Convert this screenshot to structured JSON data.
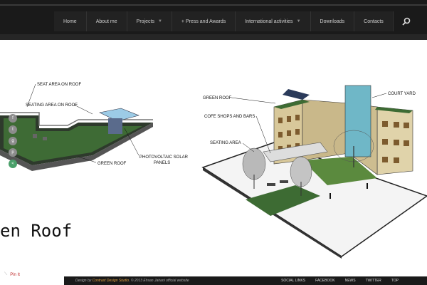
{
  "nav": {
    "items": [
      {
        "label": "Home",
        "dropdown": false
      },
      {
        "label": "About me",
        "dropdown": false
      },
      {
        "label": "Projects",
        "dropdown": true
      },
      {
        "label": "+ Press and Awards",
        "dropdown": false
      },
      {
        "label": "International activities",
        "dropdown": true
      },
      {
        "label": "Downloads",
        "dropdown": false
      },
      {
        "label": "Contacts",
        "dropdown": false
      }
    ],
    "search_icon": "search-icon"
  },
  "left_labels": {
    "seat_area_roof": "SEAT AREA ON ROOF",
    "seating_area_roof": "SEATING AREA ON ROOF",
    "photovoltaic": "PHOTOVOLTAIC SOLAR",
    "panels": "PANELS",
    "green_roof": "GREEN ROOF"
  },
  "right_labels": {
    "green_roof": "GREEN ROOF",
    "court_yard": "COURT YARD",
    "cofe_shops": "COFE SHOPS AND BARS",
    "seating_area": "SEATING AREA"
  },
  "title": "en Roof",
  "pin_label": "Pin It",
  "footer": {
    "credit_prefix": "Design by",
    "studio": "Contrast Design Studio",
    "credit_suffix": ". © 2013 Ehsan Jahani official website",
    "links": [
      "SOCIAL LINKS",
      "FACEBOOK",
      "NEWS",
      "TWITTER",
      "TOP"
    ]
  }
}
